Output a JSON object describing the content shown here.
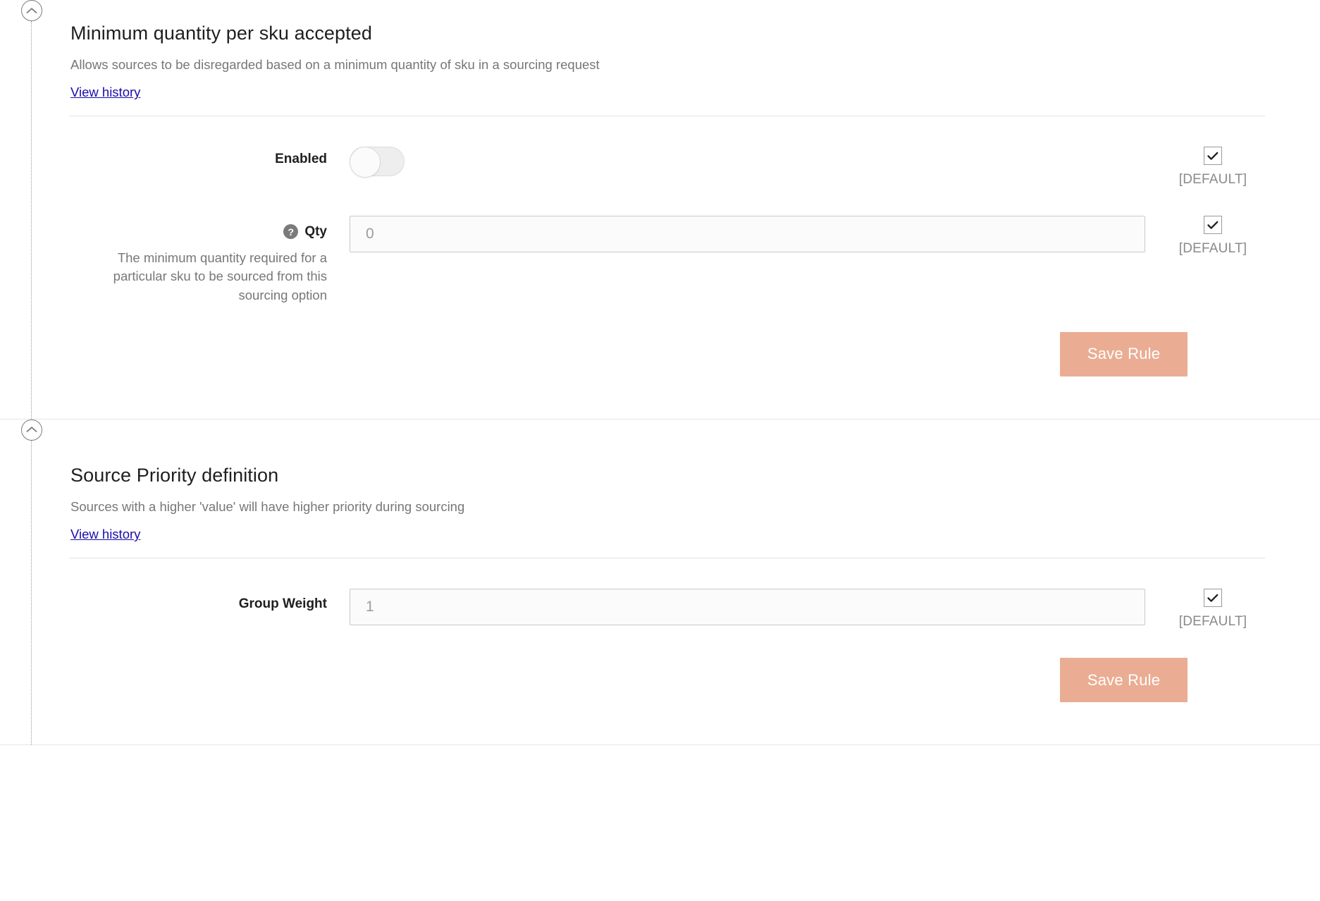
{
  "sections": [
    {
      "title": "Minimum quantity per sku accepted",
      "description": "Allows sources to be disregarded based on a minimum quantity of sku in a sourcing request",
      "history_link": "View history",
      "enabled_label": "Enabled",
      "enabled_value": "off",
      "enabled_default_label": "[DEFAULT]",
      "qty_label": "Qty",
      "qty_help_icon": "question-mark-icon",
      "qty_placeholder": "0",
      "qty_value": "",
      "qty_description": "The minimum quantity required for a particular sku to be sourced from this sourcing option",
      "qty_default_label": "[DEFAULT]",
      "save_label": "Save Rule"
    },
    {
      "title": "Source Priority definition",
      "description": "Sources with a higher 'value' will have higher priority during sourcing",
      "history_link": "View history",
      "group_weight_label": "Group Weight",
      "group_weight_placeholder": "1",
      "group_weight_value": "",
      "group_weight_default_label": "[DEFAULT]",
      "save_label": "Save Rule"
    }
  ],
  "icons": {
    "collapse": "chevron-up-circle-icon",
    "checkmark": "check-icon"
  },
  "colors": {
    "accent_button": "#eaad93",
    "link": "#1a0dab",
    "muted_text": "#777777",
    "divider": "#e2e2e2"
  }
}
